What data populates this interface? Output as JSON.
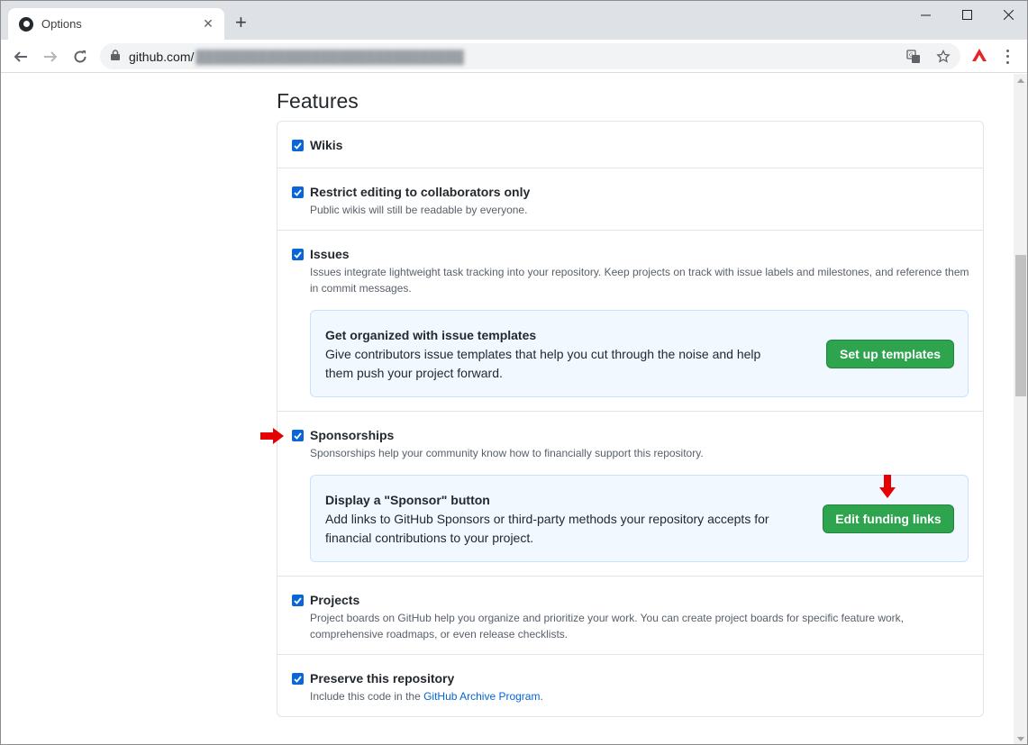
{
  "browser": {
    "tab_title": "Options",
    "url_host": "github.com/",
    "url_path": "██████████████████████████████"
  },
  "features": {
    "heading": "Features",
    "wikis": {
      "label": "Wikis",
      "checked": true
    },
    "restrict": {
      "label": "Restrict editing to collaborators only",
      "note": "Public wikis will still be readable by everyone.",
      "checked": true
    },
    "issues": {
      "label": "Issues",
      "note": "Issues integrate lightweight task tracking into your repository. Keep projects on track with issue labels and milestones, and reference them in commit messages.",
      "checked": true,
      "callout": {
        "title": "Get organized with issue templates",
        "text": "Give contributors issue templates that help you cut through the noise and help them push your project forward.",
        "button": "Set up templates"
      }
    },
    "sponsorships": {
      "label": "Sponsorships",
      "note": "Sponsorships help your community know how to financially support this repository.",
      "checked": true,
      "callout": {
        "title": "Display a \"Sponsor\" button",
        "text": "Add links to GitHub Sponsors or third-party methods your repository accepts for financial contributions to your project.",
        "button": "Edit funding links"
      }
    },
    "projects": {
      "label": "Projects",
      "note": "Project boards on GitHub help you organize and prioritize your work. You can create project boards for specific feature work, comprehensive roadmaps, or even release checklists.",
      "checked": true
    },
    "preserve": {
      "label": "Preserve this repository",
      "note_prefix": "Include this code in the ",
      "note_link": "GitHub Archive Program",
      "note_suffix": ".",
      "checked": true
    }
  },
  "colors": {
    "checkbox": "#0a66d8",
    "green_button": "#2ea44f",
    "annotation_arrow": "#e60000",
    "link": "#0366d6"
  }
}
